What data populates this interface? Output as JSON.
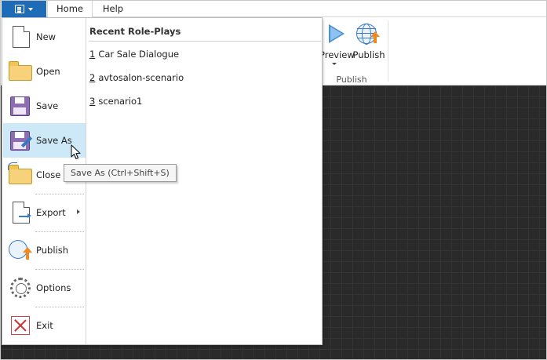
{
  "tabs": {
    "home": "Home",
    "help": "Help"
  },
  "file_button": {
    "icon": "menu-icon"
  },
  "ribbon": {
    "preview_label": "Preview",
    "publish_label": "Publish",
    "group_label": "Publish"
  },
  "menu": {
    "items": [
      {
        "label": "New",
        "icon": "new-document-icon"
      },
      {
        "label": "Open",
        "icon": "folder-icon"
      },
      {
        "label": "Save",
        "icon": "floppy-disk-icon"
      },
      {
        "label": "Save As",
        "icon": "save-as-icon"
      },
      {
        "label": "Close",
        "icon": "close-folder-icon"
      },
      {
        "label": "Export",
        "icon": "export-icon"
      },
      {
        "label": "Publish",
        "icon": "globe-upload-icon"
      },
      {
        "label": "Options",
        "icon": "gear-icon"
      },
      {
        "label": "Exit",
        "icon": "exit-icon"
      }
    ],
    "hovered": "Save As"
  },
  "recent": {
    "title": "Recent Role-Plays",
    "items": [
      {
        "num": "1",
        "name": "Car Sale Dialogue"
      },
      {
        "num": "2",
        "name": "avtosalon-scenario"
      },
      {
        "num": "3",
        "name": "scenario1"
      }
    ]
  },
  "tooltip": {
    "text": "Save As (Ctrl+Shift+S)"
  },
  "colors": {
    "accent": "#1e6bb8",
    "hover": "#cde8f7",
    "canvas": "#2a2a2a"
  }
}
